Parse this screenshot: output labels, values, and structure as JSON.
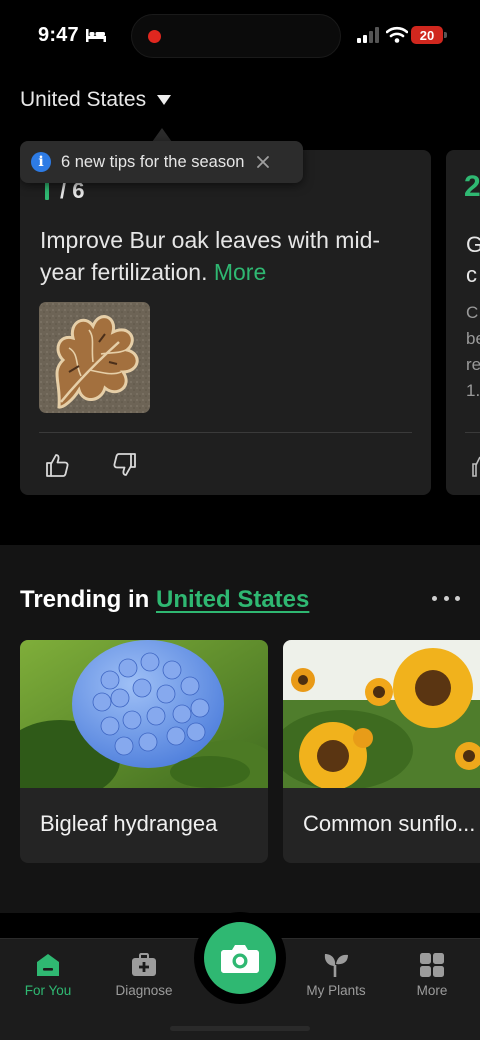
{
  "status_bar": {
    "time": "9:47",
    "battery": "20",
    "icons": [
      "bed-icon",
      "signal-icon",
      "wifi-icon",
      "battery-icon"
    ]
  },
  "country_selector": {
    "label": "United States"
  },
  "tooltip": {
    "text": "6 new tips for the season",
    "icon": "info-icon"
  },
  "tips": {
    "counter": "/ 6",
    "text": "Improve Bur oak leaves with mid-year fertilization.",
    "more_label": "More",
    "peek": {
      "number": "2",
      "title": "G\nc",
      "body": "C\nbe\nre\n1."
    }
  },
  "trending": {
    "prefix": "Trending in",
    "location": "United States",
    "items": [
      {
        "name": "Bigleaf hydrangea"
      },
      {
        "name": "Common sunflo..."
      }
    ]
  },
  "nav": {
    "items": [
      {
        "label": "For You",
        "icon": "home-icon",
        "active": true
      },
      {
        "label": "Diagnose",
        "icon": "medkit-icon",
        "active": false
      },
      {
        "label": "My Plants",
        "icon": "sprout-icon",
        "active": false
      },
      {
        "label": "More",
        "icon": "grid-icon",
        "active": false
      }
    ]
  },
  "colors": {
    "accent": "#2fb872",
    "background": "#000000",
    "card": "#1f1f1f",
    "info": "#2d7be5",
    "battery": "#d0271e"
  }
}
